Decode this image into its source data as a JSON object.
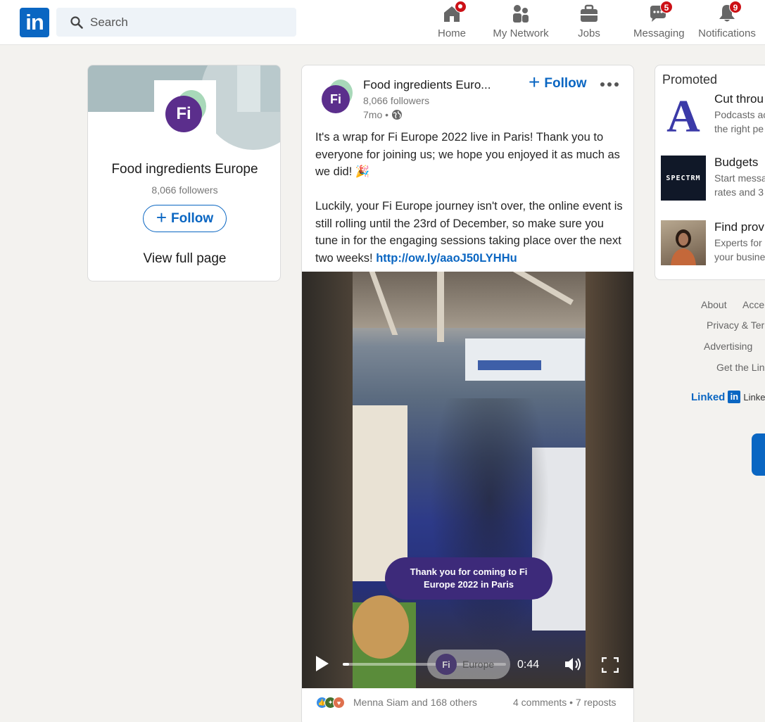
{
  "nav": {
    "search_placeholder": "Search",
    "items": [
      {
        "label": "Home",
        "icon": "home-icon",
        "badge": ""
      },
      {
        "label": "My Network",
        "icon": "network-icon",
        "badge": ""
      },
      {
        "label": "Jobs",
        "icon": "briefcase-icon",
        "badge": ""
      },
      {
        "label": "Messaging",
        "icon": "messaging-icon",
        "badge": "5"
      },
      {
        "label": "Notifications",
        "icon": "bell-icon",
        "badge": "9"
      }
    ],
    "accent": "#0a66c2",
    "badge_color": "#cc1016"
  },
  "left_card": {
    "logo_text": "Fi",
    "name": "Food ingredients Europe",
    "followers": "8,066 followers",
    "follow_label": "Follow",
    "view_label": "View full page"
  },
  "post": {
    "author": "Food ingredients Euro...",
    "logo_text": "Fi",
    "followers": "8,066 followers",
    "time": "7mo •",
    "follow_label": "Follow",
    "text_line1": "It's a wrap for Fi Europe 2022 live in Paris! Thank you to everyone for joining us; we hope you enjoyed it as much as we did! 🎉",
    "text_line2": "Luckily, your Fi Europe journey isn't over, the online event is still rolling until the 23rd of December, so make sure you tune in for the engaging sessions taking place over the next two weeks! ",
    "link": "http://ow.ly/aaoJ50LYHHu",
    "video": {
      "overlay": "Thank you for coming to Fi Europe 2022 in Paris",
      "watermark_logo": "Fi",
      "watermark_text": "Europe",
      "time": "0:44",
      "progress": 0.04
    },
    "reactions_text": "Menna Siam and 168 others",
    "counts_text": "4 comments • 7 reposts"
  },
  "promoted": {
    "title": "Promoted",
    "ads": [
      {
        "title": "Cut throu",
        "desc1": "Podcasts ac",
        "desc2": "the right pe",
        "thumb": "A"
      },
      {
        "title": "Budgets",
        "desc1": "Start messa",
        "desc2": "rates and 3",
        "thumb": "SPECTRM"
      },
      {
        "title": "Find prov",
        "desc1": "Experts for",
        "desc2": "your busine",
        "thumb": ""
      }
    ]
  },
  "footer": {
    "about": "About",
    "access": "Acce",
    "privacy": "Privacy & Ter",
    "advertising": "Advertising",
    "get": "Get the Lin",
    "brand_text": "Linked",
    "brand_box": "in",
    "brand_tail": "Linke"
  }
}
